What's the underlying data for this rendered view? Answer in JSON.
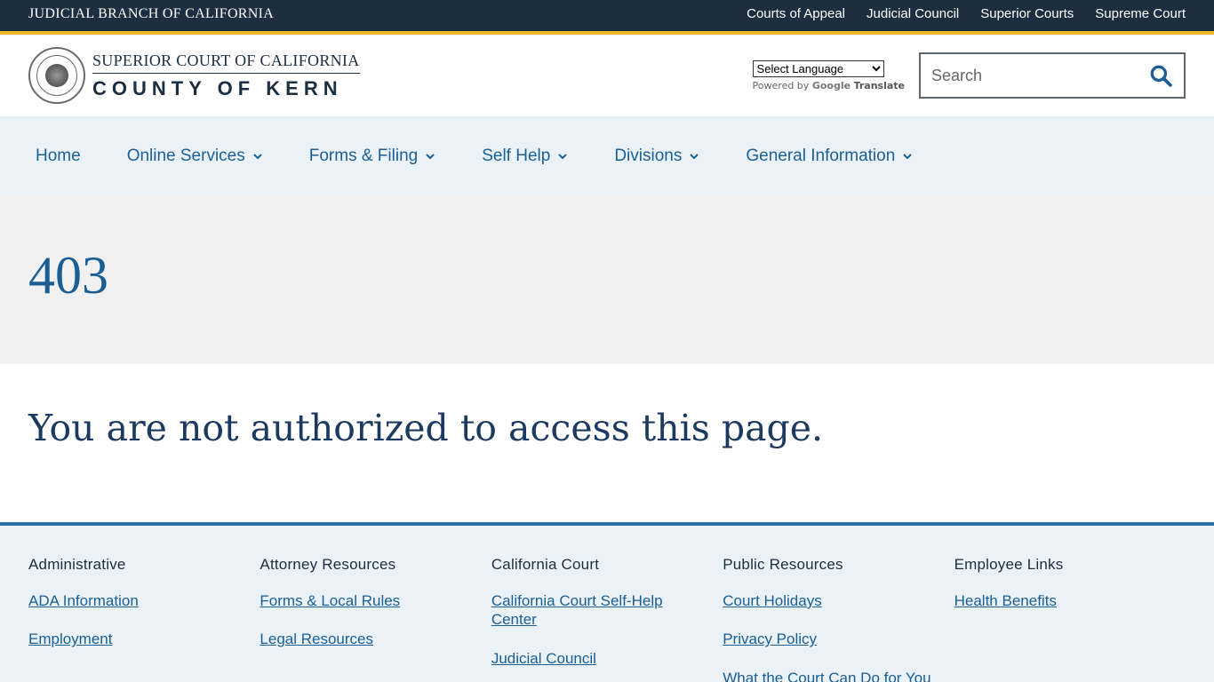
{
  "topbar": {
    "brand": "JUDICIAL BRANCH OF CALIFORNIA",
    "links": [
      "Courts of Appeal",
      "Judicial Council",
      "Superior Courts",
      "Supreme Court"
    ]
  },
  "header": {
    "logo_line1": "SUPERIOR COURT OF CALIFORNIA",
    "logo_line2": "COUNTY OF KERN",
    "translate_select": "Select Language",
    "powered_by": "Powered by",
    "powered_google": "Google",
    "powered_translate": "Translate",
    "search_placeholder": "Search"
  },
  "nav": {
    "items": [
      {
        "label": "Home"
      },
      {
        "label": "Online Services"
      },
      {
        "label": "Forms & Filing"
      },
      {
        "label": "Self Help"
      },
      {
        "label": "Divisions"
      },
      {
        "label": "General Information"
      }
    ]
  },
  "hero": {
    "title": "403"
  },
  "content": {
    "message": "You are not authorized to access this page."
  },
  "footer": {
    "columns": [
      {
        "heading": "Administrative",
        "links": [
          "ADA Information",
          "Employment"
        ]
      },
      {
        "heading": "Attorney Resources",
        "links": [
          "Forms & Local Rules",
          "Legal Resources"
        ]
      },
      {
        "heading": "California Court",
        "links": [
          "California Court Self-Help Center",
          "Judicial Council"
        ]
      },
      {
        "heading": "Public Resources",
        "links": [
          "Court Holidays",
          "Privacy Policy",
          "What the Court Can Do for You"
        ]
      },
      {
        "heading": "Employee Links",
        "links": [
          "Health Benefits"
        ]
      }
    ]
  },
  "colors": {
    "topbar_bg": "#1c2e3f",
    "accent_gold": "#f1b928",
    "link_blue": "#1a5e94",
    "nav_bg": "#eaf2f8",
    "hero_bg": "#f1f1f1"
  }
}
